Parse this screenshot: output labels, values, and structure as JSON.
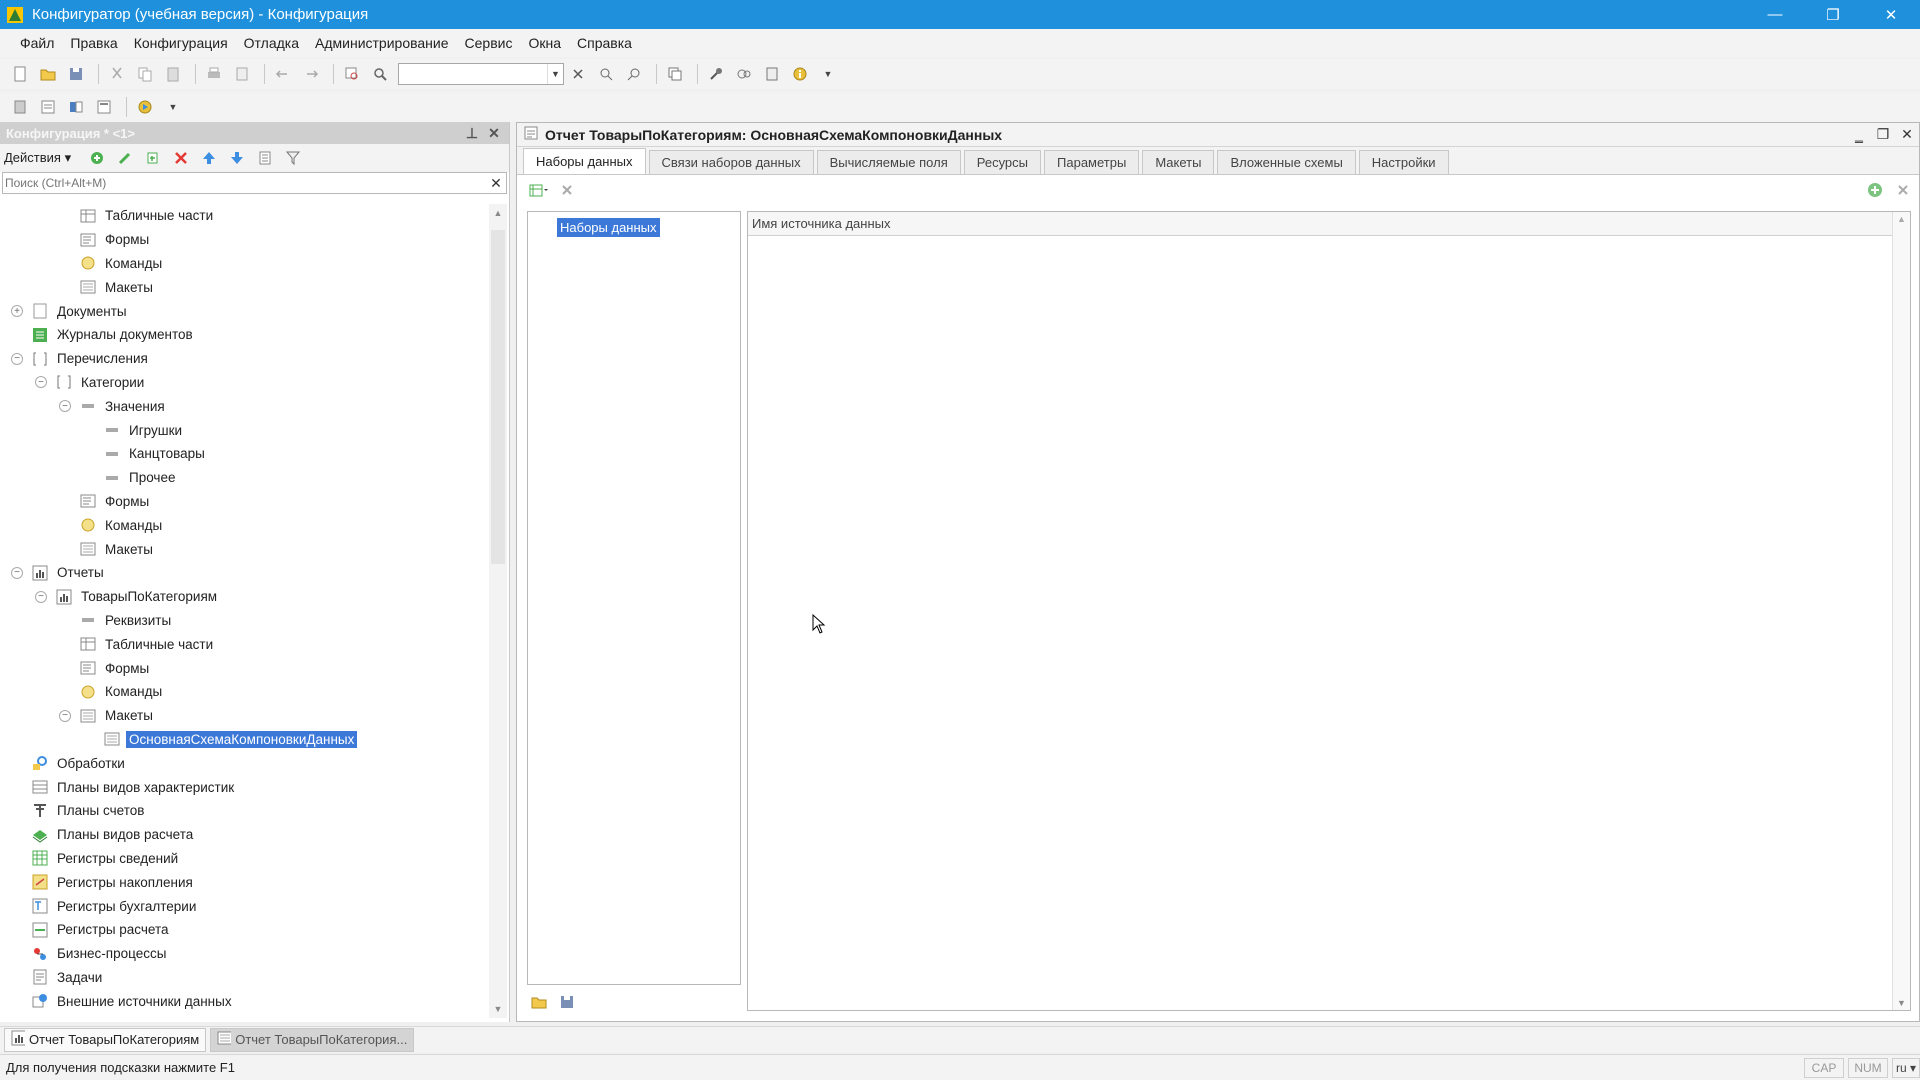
{
  "window": {
    "title": "Конфигуратор (учебная версия) - Конфигурация",
    "minimize": "—",
    "restore": "❐",
    "close": "✕"
  },
  "menu": [
    "Файл",
    "Правка",
    "Конфигурация",
    "Отладка",
    "Администрирование",
    "Сервис",
    "Окна",
    "Справка"
  ],
  "left_panel": {
    "title": "Конфигурация * <1>",
    "pin": "⊥",
    "close": "✕",
    "actions_label": "Действия ▾",
    "search_placeholder": "Поиск (Ctrl+Alt+M)",
    "search_clear": "✕",
    "tree": [
      {
        "label": "Табличные части",
        "level": 2,
        "icon": "table-icon"
      },
      {
        "label": "Формы",
        "level": 2,
        "icon": "form-icon"
      },
      {
        "label": "Команды",
        "level": 2,
        "icon": "command-icon"
      },
      {
        "label": "Макеты",
        "level": 2,
        "icon": "template-icon"
      },
      {
        "label": "Документы",
        "level": 0,
        "icon": "document-icon",
        "expander": "+"
      },
      {
        "label": "Журналы документов",
        "level": 0,
        "icon": "journal-icon"
      },
      {
        "label": "Перечисления",
        "level": 0,
        "icon": "enum-icon",
        "expander": "−"
      },
      {
        "label": "Категории",
        "level": 1,
        "icon": "enum-icon",
        "expander": "−"
      },
      {
        "label": "Значения",
        "level": 2,
        "icon": "attribute-icon",
        "expander": "−"
      },
      {
        "label": "Игрушки",
        "level": 3,
        "icon": "attribute-icon"
      },
      {
        "label": "Канцтовары",
        "level": 3,
        "icon": "attribute-icon"
      },
      {
        "label": "Прочее",
        "level": 3,
        "icon": "attribute-icon"
      },
      {
        "label": "Формы",
        "level": 2,
        "icon": "form-icon"
      },
      {
        "label": "Команды",
        "level": 2,
        "icon": "command-icon"
      },
      {
        "label": "Макеты",
        "level": 2,
        "icon": "template-icon"
      },
      {
        "label": "Отчеты",
        "level": 0,
        "icon": "report-icon",
        "expander": "−"
      },
      {
        "label": "ТоварыПоКатегориям",
        "level": 1,
        "icon": "report-icon",
        "expander": "−"
      },
      {
        "label": "Реквизиты",
        "level": 2,
        "icon": "attribute-icon"
      },
      {
        "label": "Табличные части",
        "level": 2,
        "icon": "table-icon"
      },
      {
        "label": "Формы",
        "level": 2,
        "icon": "form-icon"
      },
      {
        "label": "Команды",
        "level": 2,
        "icon": "command-icon"
      },
      {
        "label": "Макеты",
        "level": 2,
        "icon": "template-icon",
        "expander": "−"
      },
      {
        "label": "ОсновнаяСхемаКомпоновкиДанных",
        "level": 3,
        "icon": "template-icon",
        "selected": true
      },
      {
        "label": "Обработки",
        "level": 0,
        "icon": "processing-icon"
      },
      {
        "label": "Планы видов характеристик",
        "level": 0,
        "icon": "chart-of-characteristics-icon"
      },
      {
        "label": "Планы счетов",
        "level": 0,
        "icon": "chart-of-accounts-icon"
      },
      {
        "label": "Планы видов расчета",
        "level": 0,
        "icon": "chart-of-calculation-icon"
      },
      {
        "label": "Регистры сведений",
        "level": 0,
        "icon": "info-register-icon"
      },
      {
        "label": "Регистры накопления",
        "level": 0,
        "icon": "accumulation-register-icon"
      },
      {
        "label": "Регистры бухгалтерии",
        "level": 0,
        "icon": "accounting-register-icon"
      },
      {
        "label": "Регистры расчета",
        "level": 0,
        "icon": "calculation-register-icon"
      },
      {
        "label": "Бизнес-процессы",
        "level": 0,
        "icon": "business-process-icon"
      },
      {
        "label": "Задачи",
        "level": 0,
        "icon": "task-icon"
      },
      {
        "label": "Внешние источники данных",
        "level": 0,
        "icon": "external-source-icon"
      }
    ]
  },
  "document": {
    "title": "Отчет ТоварыПоКатегориям: ОсновнаяСхемаКомпоновкиДанных",
    "tabs": [
      "Наборы данных",
      "Связи наборов данных",
      "Вычисляемые поля",
      "Ресурсы",
      "Параметры",
      "Макеты",
      "Вложенные схемы",
      "Настройки"
    ],
    "active_tab": 0,
    "datasets_node": "Наборы данных",
    "column_header": "Имя источника данных"
  },
  "taskbar": [
    {
      "label": "Отчет ТоварыПоКатегориям",
      "icon": "report-icon",
      "active": false
    },
    {
      "label": "Отчет ТоварыПоКатегория...",
      "icon": "template-icon",
      "active": true
    }
  ],
  "status": {
    "hint": "Для получения подсказки нажмите F1",
    "cap": "CAP",
    "num": "NUM",
    "lang": "ru ▾"
  },
  "colors": {
    "titlebar": "#1e90dc",
    "selection": "#3c78d8"
  }
}
